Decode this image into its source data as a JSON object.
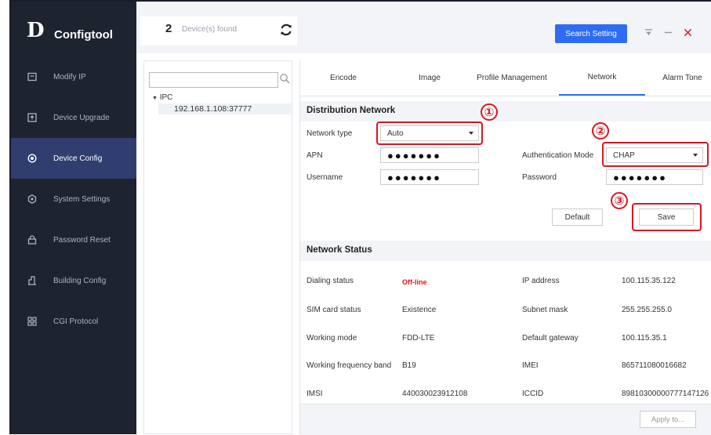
{
  "app": {
    "logo_mark": "D",
    "name": "Configtool"
  },
  "sidebar": {
    "items": [
      {
        "label": "Modify IP",
        "icon": "monitor-icon"
      },
      {
        "label": "Device Upgrade",
        "icon": "upload-icon"
      },
      {
        "label": "Device Config",
        "icon": "target-icon"
      },
      {
        "label": "System Settings",
        "icon": "settings-icon"
      },
      {
        "label": "Password Reset",
        "icon": "lock-icon"
      },
      {
        "label": "Building Config",
        "icon": "building-icon"
      },
      {
        "label": "CGI Protocol",
        "icon": "grid-icon"
      }
    ],
    "active_index": 2
  },
  "topbar": {
    "count": "2",
    "found_text": "Device(s) found",
    "search_setting": "Search Setting"
  },
  "tree": {
    "search_placeholder": "",
    "root": "IPC",
    "device": "192.168.1.108:37777"
  },
  "tabs": [
    "Encode",
    "Image",
    "Profile Management",
    "Network",
    "Alarm Tone"
  ],
  "active_tab": "Network",
  "distribution": {
    "title": "Distribution Network",
    "network_type_label": "Network type",
    "network_type_value": "Auto",
    "apn_label": "APN",
    "apn_value": "●●●●●●●",
    "auth_label": "Authentication Mode",
    "auth_value": "CHAP",
    "username_label": "Username",
    "username_value": "●●●●●●●",
    "password_label": "Password",
    "password_value": "●●●●●●●",
    "default_btn": "Default",
    "save_btn": "Save"
  },
  "annotations": [
    "①",
    "②",
    "③"
  ],
  "status": {
    "title": "Network Status",
    "rows": [
      {
        "l1": "Dialing status",
        "v1": "Off-line",
        "l2": "IP address",
        "v2": "100.115.35.122"
      },
      {
        "l1": "SIM card status",
        "v1": "Existence",
        "l2": "Subnet mask",
        "v2": "255.255.255.0"
      },
      {
        "l1": "Working mode",
        "v1": "FDD-LTE",
        "l2": "Default gateway",
        "v2": "100.115.35.1"
      },
      {
        "l1": "Working frequency band",
        "v1": "B19",
        "l2": "IMEI",
        "v2": "865711080016682"
      },
      {
        "l1": "IMSI",
        "v1": "440030023912108",
        "l2": "ICCID",
        "v2": "89810300000777147126"
      }
    ]
  },
  "footer": {
    "apply": "Apply to..."
  },
  "colors": {
    "accent": "#2e6cf6",
    "sidebar": "#1e2330",
    "annotation": "#e0141e",
    "offline": "#e0141e"
  }
}
